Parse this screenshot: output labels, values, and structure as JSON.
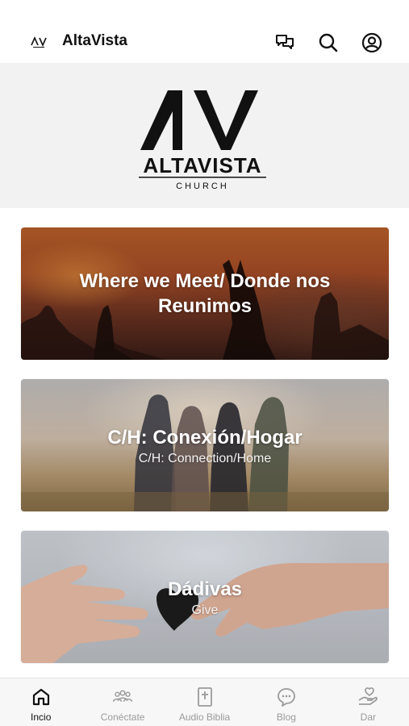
{
  "status_bar": {
    "text": ""
  },
  "header": {
    "title": "AltaVista",
    "icons": [
      "chat-icon",
      "search-icon",
      "profile-icon"
    ]
  },
  "hero": {
    "logo_letters": "AV",
    "logo_name": "ALTAVISTA",
    "logo_sub": "CHURCH"
  },
  "cards": [
    {
      "title": "Where we Meet/ Donde nos Reunimos",
      "subtitle": ""
    },
    {
      "title": "C/H: Conexión/Hogar",
      "subtitle": "C/H: Connection/Home"
    },
    {
      "title": "Dádivas",
      "subtitle": "Give"
    }
  ],
  "tabs": [
    {
      "label": "Incio",
      "icon": "home-icon",
      "active": true
    },
    {
      "label": "Conéctate",
      "icon": "people-icon",
      "active": false
    },
    {
      "label": "Audio Biblia",
      "icon": "bible-icon",
      "active": false
    },
    {
      "label": "Blog",
      "icon": "blog-bubble-icon",
      "active": false
    },
    {
      "label": "Dar",
      "icon": "give-hand-icon",
      "active": false
    }
  ],
  "colors": {
    "active_tab": "#111111",
    "inactive_tab": "#9a9a9a",
    "hero_bg": "#f2f2f2"
  }
}
